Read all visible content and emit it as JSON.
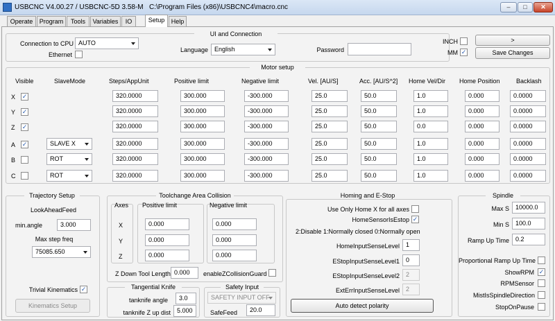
{
  "window": {
    "title": "USBCNC V4.00.27 / USBCNC-5D 3.58-M",
    "path": "C:\\Program Files (x86)\\USBCNC4\\macro.cnc",
    "minimize_glyph": "–",
    "maximize_glyph": "□",
    "close_glyph": "✕"
  },
  "tabs": [
    "Operate",
    "Program",
    "Tools",
    "Variables",
    "IO",
    "Setup",
    "Help"
  ],
  "ui": {
    "title": "UI and Connection",
    "connection_label": "Connection to CPU",
    "connection_value": "AUTO",
    "ethernet_label": "Ethernet",
    "language_label": "Language",
    "language_value": "English",
    "password_label": "Password",
    "password_value": "",
    "inch_label": "INCH",
    "mm_label": "MM",
    "next_label": ">",
    "save_label": "Save Changes"
  },
  "motor": {
    "title": "Motor setup",
    "headers": {
      "visible": "Visible",
      "slavemode": "SlaveMode",
      "steps": "Steps/AppUnit",
      "poslimit": "Positive limit",
      "neglimit": "Negative limit",
      "vel": "Vel. [AU/S]",
      "acc": "Acc. [AU/S^2]",
      "homevel": "Home Vel/Dir",
      "homepos": "Home Position",
      "backlash": "Backlash"
    },
    "axes": [
      {
        "axis": "X",
        "visible": true,
        "slave": "",
        "steps": "320.0000",
        "pos": "300.000",
        "neg": "-300.000",
        "vel": "25.0",
        "acc": "50.0",
        "homevel": "1.0",
        "homepos": "0.000",
        "backlash": "0.0000"
      },
      {
        "axis": "Y",
        "visible": true,
        "slave": "",
        "steps": "320.0000",
        "pos": "300.000",
        "neg": "-300.000",
        "vel": "25.0",
        "acc": "50.0",
        "homevel": "1.0",
        "homepos": "0.000",
        "backlash": "0.0000"
      },
      {
        "axis": "Z",
        "visible": true,
        "slave": "",
        "steps": "320.0000",
        "pos": "300.000",
        "neg": "-300.000",
        "vel": "25.0",
        "acc": "50.0",
        "homevel": "0.0",
        "homepos": "0.000",
        "backlash": "0.0000"
      },
      {
        "axis": "A",
        "visible": true,
        "slave": "SLAVE X",
        "steps": "320.0000",
        "pos": "300.000",
        "neg": "-300.000",
        "vel": "25.0",
        "acc": "50.0",
        "homevel": "1.0",
        "homepos": "0.000",
        "backlash": "0.0000"
      },
      {
        "axis": "B",
        "visible": false,
        "slave": "ROT",
        "steps": "320.0000",
        "pos": "300.000",
        "neg": "-300.000",
        "vel": "25.0",
        "acc": "50.0",
        "homevel": "1.0",
        "homepos": "0.000",
        "backlash": "0.0000"
      },
      {
        "axis": "C",
        "visible": false,
        "slave": "ROT",
        "steps": "320.0000",
        "pos": "300.000",
        "neg": "-300.000",
        "vel": "25.0",
        "acc": "50.0",
        "homevel": "1.0",
        "homepos": "0.000",
        "backlash": "0.0000"
      }
    ]
  },
  "trajectory": {
    "title": "Trajectory Setup",
    "lookahead_label": "LookAheadFeed",
    "minangle_label": "min.angle",
    "minangle_value": "3.000",
    "maxstep_label": "Max step freq",
    "maxstep_value": "75085.650",
    "trivial_label": "Trivial Kinematics",
    "kinematics_button": "Kinematics Setup"
  },
  "toolchange": {
    "title": "Toolchange Area Collision",
    "axes_label": "Axes",
    "pos_label": "Positive limit",
    "neg_label": "Negative limit",
    "rows": [
      {
        "axis": "X",
        "pos": "0.000",
        "neg": "0.000"
      },
      {
        "axis": "Y",
        "pos": "0.000",
        "neg": "0.000"
      },
      {
        "axis": "Z",
        "pos": "0.000",
        "neg": "0.000"
      }
    ],
    "zdown_label": "Z Down Tool Length",
    "zdown_value": "0.000",
    "enablez_label": "enableZCollisionGuard"
  },
  "knife": {
    "title": "Tangential Knife",
    "angle_label": "tanknife angle",
    "angle_value": "3.0",
    "zup_label": "tanknife Z up dist",
    "zup_value": "5.000"
  },
  "safety": {
    "title": "Safety Input",
    "combo_value": "SAFETY INPUT OFF",
    "safefeed_label": "SafeFeed",
    "safefeed_value": "20.0"
  },
  "homing": {
    "title": "Homing and E-Stop",
    "use_only_label": "Use Only Home X for all axes",
    "home_estop_label": "HomeSensorIsEstop",
    "legend": "2:Disable 1:Normally closed 0:Normally open",
    "home_level_label": "HomeInputSenseLevel",
    "home_level_value": "1",
    "estop1_label": "EStopInputSenseLevel1",
    "estop1_value": "0",
    "estop2_label": "EStopInputSenseLevel2",
    "estop2_value": "2",
    "exterr_label": "ExtErrInputSenseLevel",
    "exterr_value": "2",
    "autodetect_button": "Auto detect polarity"
  },
  "spindle": {
    "title": "Spindle",
    "maxs_label": "Max S",
    "maxs_value": "10000.0",
    "mins_label": "Min S",
    "mins_value": "100.0",
    "ramp_label": "Ramp Up Time",
    "ramp_value": "0.2",
    "prop_label": "Proportional Ramp Up Time",
    "showrpm_label": "ShowRPM",
    "rpmsensor_label": "RPMSensor",
    "mist_label": "MistIsSpindleDirection",
    "stop_label": "StopOnPause"
  },
  "check_glyph": "✓"
}
